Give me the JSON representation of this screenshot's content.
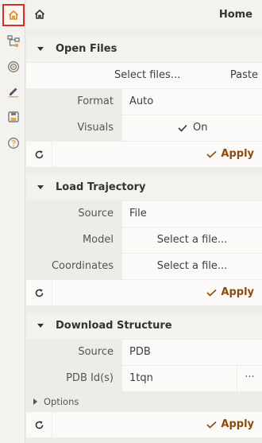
{
  "header": {
    "title": "Home"
  },
  "toolbar": {
    "items": [
      {
        "icon": "home-icon",
        "active": true
      },
      {
        "icon": "structure-tree-icon"
      },
      {
        "icon": "focus-target-icon"
      },
      {
        "icon": "pencil-icon"
      },
      {
        "icon": "save-icon"
      },
      {
        "icon": "help-icon"
      }
    ]
  },
  "open_files": {
    "title": "Open Files",
    "select_files_label": "Select files...",
    "paste_label": "Paste",
    "format_label": "Format",
    "format_value": "Auto",
    "visuals_label": "Visuals",
    "visuals_value": "On",
    "apply_label": "Apply"
  },
  "load_trajectory": {
    "title": "Load Trajectory",
    "source_label": "Source",
    "source_value": "File",
    "model_label": "Model",
    "model_value": "Select a file...",
    "coordinates_label": "Coordinates",
    "coordinates_value": "Select a file...",
    "apply_label": "Apply"
  },
  "download_structure": {
    "title": "Download Structure",
    "source_label": "Source",
    "source_value": "PDB",
    "pdb_id_label": "PDB Id(s)",
    "pdb_id_value": "1tqn",
    "more_label": "···",
    "options_label": "Options",
    "apply_label": "Apply"
  },
  "colors": {
    "accent": "#8a4b0f",
    "toolbar_icon": "#e0a95a",
    "highlight": "#d32f2f"
  }
}
